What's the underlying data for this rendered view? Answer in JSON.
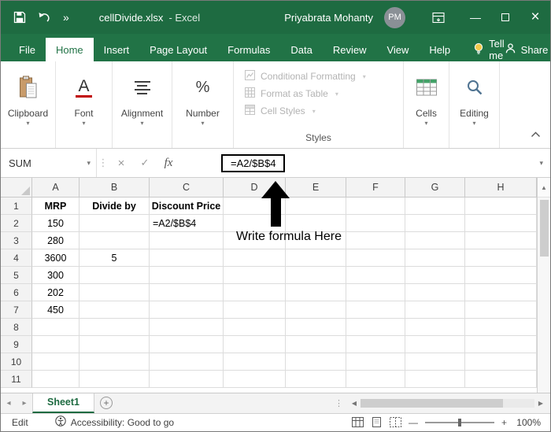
{
  "icons": {
    "more": "»",
    "minimize": "—",
    "close": "×",
    "chevron": "▾",
    "cancel": "×",
    "check": "✓",
    "fx": "fx",
    "percent": "%",
    "font_letter": "A",
    "up_small": "▲",
    "left_small": "◀",
    "right_small": "▶",
    "tab_left": "◂",
    "tab_right": "▸",
    "dots": "⋮",
    "plus": "+",
    "minus": "—",
    "new_sheet": "+"
  },
  "title_bar": {
    "filename": "cellDivide.xlsx",
    "app": "-  Excel",
    "user_name": "Priyabrata Mohanty",
    "avatar_initials": "PM"
  },
  "tabs": {
    "file": "File",
    "items": [
      "Home",
      "Insert",
      "Page Layout",
      "Formulas",
      "Data",
      "Review",
      "View",
      "Help"
    ],
    "active": "Home",
    "tell_me": "Tell me",
    "share": "Share"
  },
  "ribbon": {
    "groups": {
      "clipboard": "Clipboard",
      "font": "Font",
      "alignment": "Alignment",
      "number": "Number",
      "cells": "Cells",
      "editing": "Editing"
    },
    "styles_group": {
      "items": [
        "Conditional Formatting",
        "Format as Table",
        "Cell Styles"
      ],
      "label": "Styles"
    }
  },
  "formula_bar": {
    "name_box": "SUM",
    "formula": "=A2/$B$4"
  },
  "annotation": {
    "text": "Write formula Here"
  },
  "grid": {
    "col_headers": [
      "A",
      "B",
      "C",
      "D",
      "E",
      "F",
      "G",
      "H"
    ],
    "rows": [
      {
        "num": "1",
        "header": true,
        "cells": {
          "A": "MRP",
          "B": "Divide by",
          "C": "Discount Price"
        }
      },
      {
        "num": "2",
        "cells": {
          "A": "150",
          "C": "=A2/$B$4"
        }
      },
      {
        "num": "3",
        "cells": {
          "A": "280"
        }
      },
      {
        "num": "4",
        "cells": {
          "A": "3600",
          "B": "5"
        }
      },
      {
        "num": "5",
        "cells": {
          "A": "300"
        }
      },
      {
        "num": "6",
        "cells": {
          "A": "202"
        }
      },
      {
        "num": "7",
        "cells": {
          "A": "450"
        }
      },
      {
        "num": "8",
        "cells": {}
      },
      {
        "num": "9",
        "cells": {}
      },
      {
        "num": "10",
        "cells": {}
      },
      {
        "num": "11",
        "cells": {}
      }
    ]
  },
  "sheet_bar": {
    "active_sheet": "Sheet1"
  },
  "status_bar": {
    "mode": "Edit",
    "accessibility": "Accessibility: Good to go",
    "zoom": "100%"
  },
  "colors": {
    "excel_green": "#217346",
    "title_green": "#1e6b41"
  }
}
